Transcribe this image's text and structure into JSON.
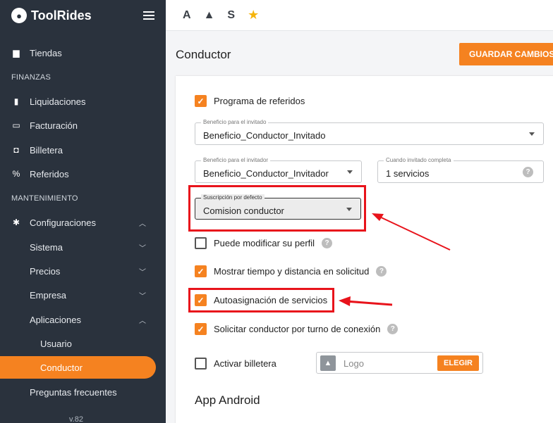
{
  "sidebar": {
    "brand": "ToolRides",
    "items": [
      {
        "label": "Tiendas",
        "icon": "store-icon"
      },
      {
        "section": "FINANZAS"
      },
      {
        "label": "Liquidaciones",
        "icon": "clipboard-icon"
      },
      {
        "label": "Facturación",
        "icon": "credit-card-icon"
      },
      {
        "label": "Billetera",
        "icon": "wallet-icon"
      },
      {
        "label": "Referidos",
        "icon": "percent-icon"
      },
      {
        "section": "MANTENIMIENTO"
      },
      {
        "label": "Configuraciones",
        "icon": "gear-icon"
      },
      {
        "label": "Sistema"
      },
      {
        "label": "Precios"
      },
      {
        "label": "Empresa"
      },
      {
        "label": "Aplicaciones"
      },
      {
        "label": "Usuario"
      },
      {
        "label": "Conductor"
      },
      {
        "label": "Preguntas frecuentes"
      }
    ],
    "version": "v.82"
  },
  "topbar": {
    "icon1": "A",
    "icon2": "▲",
    "icon3": "S",
    "icon4": "★"
  },
  "page": {
    "title": "Conductor",
    "save_label": "GUARDAR CAMBIOS"
  },
  "form": {
    "referral_program": "Programa de referidos",
    "invitee_benefit_label": "Beneficio para el invitado",
    "invitee_benefit_value": "Beneficio_Conductor_Invitado",
    "inviter_benefit_label": "Beneficio para el invitador",
    "inviter_benefit_value": "Beneficio_Conductor_Invitador",
    "invitee_complete_label": "Cuando invitado completa",
    "invitee_complete_value": "1 servicios",
    "default_subscription_label": "Suscripción por defecto",
    "default_subscription_value": "Comision conductor",
    "edit_profile": "Puede modificar su perfil",
    "show_time_distance": "Mostrar tiempo y distancia en solicitud",
    "auto_assign": "Autoasignación de servicios",
    "request_by_turn": "Solicitar conductor por turno de conexión",
    "activate_wallet": "Activar billetera",
    "logo_label": "Logo",
    "choose_label": "ELEGIR",
    "help": "?",
    "check": "✓"
  },
  "section": {
    "title": "App Android"
  },
  "colors": {
    "accent": "#f58220",
    "sidebar": "#2a323d",
    "highlight": "#e8131b"
  }
}
